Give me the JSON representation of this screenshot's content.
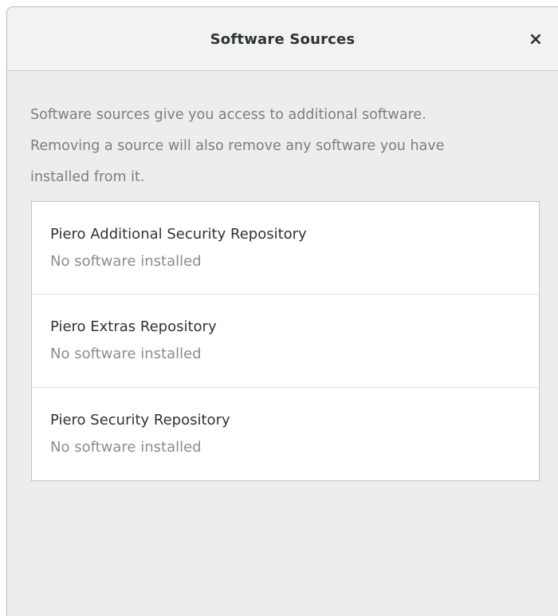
{
  "dialog": {
    "title": "Software Sources",
    "close_label": "×",
    "description_lines": [
      "Software sources give you access to additional software.",
      "Removing a source will also remove any software you have",
      "installed from it."
    ]
  },
  "repositories": [
    {
      "name": "Piero Additional Security Repository",
      "status": "No software installed"
    },
    {
      "name": "Piero Extras Repository",
      "status": "No software installed"
    },
    {
      "name": "Piero Security Repository",
      "status": "No software installed"
    }
  ],
  "colors": {
    "background": "#ededed",
    "title_text": "#2e3436",
    "secondary_text": "#8a8e8f"
  }
}
